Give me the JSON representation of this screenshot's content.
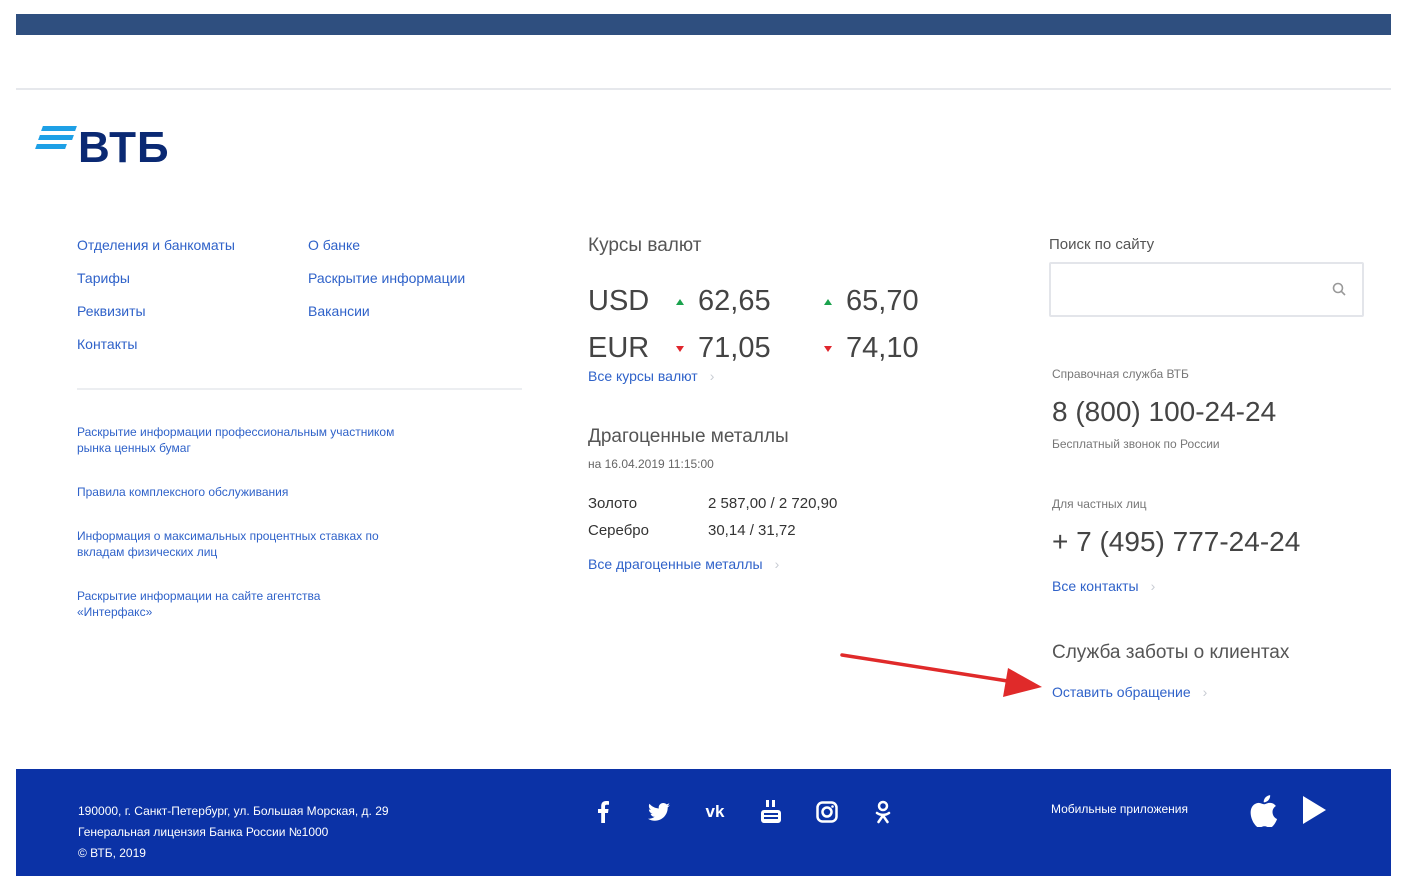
{
  "header": {
    "logo_text": "ВТБ"
  },
  "nav": {
    "col1": [
      "Отделения и банкоматы",
      "Тарифы",
      "Реквизиты",
      "Контакты"
    ],
    "col2": [
      "О банке",
      "Раскрытие информации",
      "Вакансии"
    ]
  },
  "info_links": [
    "Раскрытие информации профессиональным участником рынка ценных бумаг",
    "Правила комплексного обслуживания",
    "Информация о максимальных процентных ставках по вкладам физических лиц",
    "Раскрытие информации на сайте агентства «Интерфакс»"
  ],
  "rates": {
    "title": "Курсы валют",
    "rows": [
      {
        "currency": "USD",
        "buy": "62,65",
        "sell": "65,70",
        "dir": "up"
      },
      {
        "currency": "EUR",
        "buy": "71,05",
        "sell": "74,10",
        "dir": "down"
      }
    ],
    "all_link": "Все курсы валют"
  },
  "metals": {
    "title": "Драгоценные металлы",
    "date": "на 16.04.2019 11:15:00",
    "rows": [
      {
        "name": "Золото",
        "value": "2 587,00  / 2 720,90"
      },
      {
        "name": "Серебро",
        "value": "30,14  / 31,72"
      }
    ],
    "all_link": "Все драгоценные металлы"
  },
  "search": {
    "label": "Поиск по сайту",
    "placeholder": "",
    "icon": "search-icon"
  },
  "contacts": {
    "help_label": "Справочная служба ВТБ",
    "help_phone": "8 (800) 100-24-24",
    "help_note": "Бесплатный звонок по России",
    "private_label": "Для частных лиц",
    "private_phone": "+ 7 (495) 777-24-24",
    "all_link": "Все контакты"
  },
  "care": {
    "title": "Служба заботы о клиентах",
    "link": "Оставить обращение"
  },
  "footer": {
    "address": "190000, г. Санкт-Петербург, ул. Большая Морская, д. 29",
    "license": "Генеральная лицензия Банка России №1000",
    "copyright": "© ВТБ, 2019",
    "mobile_label": "Мобильные приложения",
    "social_icons": [
      "facebook-icon",
      "twitter-icon",
      "vk-icon",
      "youtube-icon",
      "instagram-icon",
      "odnoklassniki-icon"
    ]
  },
  "colors": {
    "top_bar": "#2f4f7f",
    "footer": "#0b32a6",
    "link": "#2f62c9",
    "logo": "#0a2973",
    "logo_stripes": "#1ea0e6",
    "rate_up": "#1aa24d",
    "rate_down": "#e0262d",
    "annotation_arrow": "#e02a2a"
  }
}
